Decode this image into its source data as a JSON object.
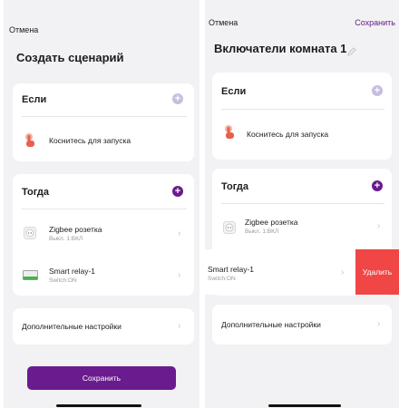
{
  "left": {
    "cancel_label": "Отмена",
    "title": "Создать сценарий",
    "if_section": {
      "title": "Если",
      "trigger_label": "Коснитесь для запуска"
    },
    "then_section": {
      "title": "Тогда",
      "items": [
        {
          "name": "Zigbee розетка",
          "status": "Выкл. 1:ВКЛ"
        },
        {
          "name": "Smart relay-1",
          "status": "Switch:ON"
        }
      ]
    },
    "advanced_label": "Дополнительные настройки",
    "save_button_label": "Сохранить"
  },
  "right": {
    "cancel_label": "Отмена",
    "save_label": "Сохранить",
    "title": "Включатели комната 1",
    "if_section": {
      "title": "Если",
      "trigger_label": "Коснитесь для запуска"
    },
    "then_section": {
      "title": "Тогда",
      "items": [
        {
          "name": "Zigbee розетка",
          "status": "Выкл. 1:ВКЛ"
        },
        {
          "name": "Smart relay-1",
          "status": "Switch:ON"
        }
      ]
    },
    "delete_label": "Удалить",
    "advanced_label": "Дополнительные настройки"
  },
  "colors": {
    "accent": "#6a1b8e",
    "accent_light": "#c7bedf",
    "delete": "#f04646",
    "background": "#f2f2f4"
  },
  "icons": [
    "hand-tap-icon",
    "plus-icon",
    "socket-icon",
    "relay-icon",
    "chevron-right-icon",
    "pencil-icon"
  ]
}
